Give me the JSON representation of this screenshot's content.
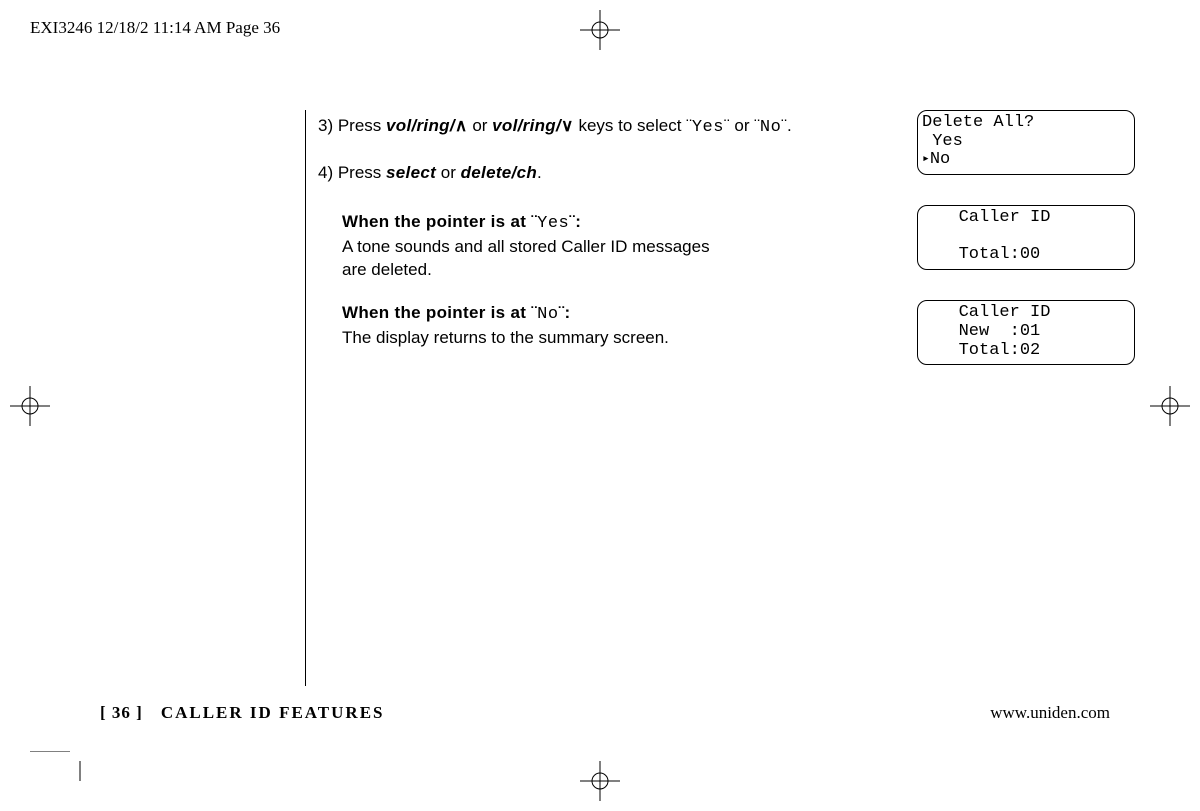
{
  "header": "EXI3246  12/18/2  11:14 AM  Page 36",
  "step3": {
    "num": "3)",
    "t1": " Press ",
    "k1": "vol/ring/",
    "arrow_up": "∧",
    "t2": " or ",
    "k2": "vol/ring/",
    "arrow_down": "∨",
    "t3": " keys to select ",
    "q1_open": "¨",
    "q1_word": "Yes",
    "q1_close": "¨",
    "t4": " or ",
    "q2_open": "¨",
    "q2_word": "No",
    "q2_close": "¨",
    "t5": "."
  },
  "step4": {
    "num": "4)",
    "t1": " Press ",
    "k1": "select",
    "t2": " or ",
    "k2": "delete/ch",
    "t3": "."
  },
  "subYes": {
    "b1": "When the pointer is at ",
    "q_open": "¨",
    "q_word": "Yes",
    "q_close": "¨",
    "b2": ":",
    "line1": "A tone sounds and all stored Caller ID messages",
    "line2": "are deleted."
  },
  "subNo": {
    "b1": "When the pointer is at ",
    "q_open": "¨",
    "q_word": "No",
    "q_close": "¨",
    "b2": ":",
    "line1": "The display returns to the summary screen."
  },
  "screen1": {
    "l1": "Delete All?",
    "l2": " Yes",
    "l3": "No"
  },
  "screen2": {
    "l1": "   Caller ID",
    "l2": "",
    "l3": "   Total:00"
  },
  "screen3": {
    "l1": "   Caller ID",
    "l2": "   New  :01",
    "l3": "   Total:02"
  },
  "footer": {
    "page": "[ 36 ]",
    "section": "CALLER ID FEATURES",
    "url": "www.uniden.com"
  }
}
